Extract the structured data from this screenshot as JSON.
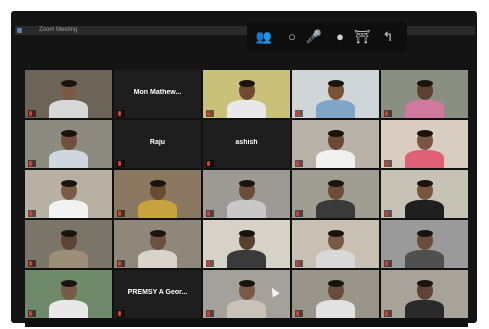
{
  "window": {
    "title": "Zoom Meeting"
  },
  "toolbar": {
    "items": [
      {
        "icon": "participants-icon",
        "glyph": "👥"
      },
      {
        "icon": "record-icon",
        "glyph": "○"
      },
      {
        "icon": "microphone-icon",
        "glyph": "🎤"
      },
      {
        "icon": "camera-icon",
        "glyph": "●"
      },
      {
        "icon": "share-icon",
        "glyph": "⛩"
      },
      {
        "icon": "leave-icon",
        "glyph": "↰"
      }
    ]
  },
  "colors": {
    "active_speaker": "#e8d631",
    "muted_mic": "#e03a2a",
    "tile_bg": "#1c1c1c"
  },
  "grid": {
    "rows": [
      [
        {
          "type": "video",
          "name": "",
          "bg": "#6b6457",
          "skin": "#7a5a45",
          "shirt": "#d8d8d8"
        },
        {
          "type": "name",
          "name": "Mon Mathew..."
        },
        {
          "type": "video",
          "name": "",
          "bg": "#c9c17a",
          "skin": "#6e4a32",
          "shirt": "#e8e8e8",
          "active": true
        },
        {
          "type": "video",
          "name": "",
          "bg": "#cfd6d8",
          "skin": "#7a5238",
          "shirt": "#7fa6c8"
        },
        {
          "type": "video",
          "name": "",
          "bg": "#8a8f83",
          "skin": "#5e4030",
          "shirt": "#d07aa0"
        }
      ],
      [
        {
          "type": "video",
          "name": "",
          "bg": "#8d8a80",
          "skin": "#70503c",
          "shirt": "#cfd6df"
        },
        {
          "type": "name",
          "name": "Raju"
        },
        {
          "type": "name",
          "name": "ashish"
        },
        {
          "type": "video",
          "name": "",
          "bg": "#b8b2a8",
          "skin": "#6c4a36",
          "shirt": "#f0f0f0"
        },
        {
          "type": "video",
          "name": "",
          "bg": "#d8cdc0",
          "skin": "#7a5542",
          "shirt": "#e0607a"
        }
      ],
      [
        {
          "type": "video",
          "name": "",
          "bg": "#b7b0a3",
          "skin": "#7b5b46",
          "shirt": "#f2f2f2"
        },
        {
          "type": "video",
          "name": "",
          "bg": "#8a7860",
          "skin": "#6a4a35",
          "shirt": "#c8a23c"
        },
        {
          "type": "video",
          "name": "",
          "bg": "#9b9a94",
          "skin": "#6a4d3a",
          "shirt": "#c8c8c8"
        },
        {
          "type": "video",
          "name": "",
          "bg": "#a09d92",
          "skin": "#6e4d38",
          "shirt": "#3a3a3a"
        },
        {
          "type": "video",
          "name": "",
          "bg": "#c7c2b6",
          "skin": "#7a5640",
          "shirt": "#1f1f1f"
        }
      ],
      [
        {
          "type": "video",
          "name": "",
          "bg": "#7b7468",
          "skin": "#5e4434",
          "shirt": "#9c8e76"
        },
        {
          "type": "video",
          "name": "",
          "bg": "#8e877a",
          "skin": "#6c5040",
          "shirt": "#d8d4cc"
        },
        {
          "type": "video",
          "name": "",
          "bg": "#d7d2c8",
          "skin": "#5a4030",
          "shirt": "#3a3a3a"
        },
        {
          "type": "video",
          "name": "",
          "bg": "#c8c0b2",
          "skin": "#7a5a44",
          "shirt": "#d8d8d8"
        },
        {
          "type": "video",
          "name": "",
          "bg": "#9a9a9a",
          "skin": "#6a4c3a",
          "shirt": "#505050"
        }
      ],
      [
        {
          "type": "video",
          "name": "",
          "bg": "#6f8a6a",
          "skin": "#7a5a46",
          "shirt": "#e8e8e8"
        },
        {
          "type": "name",
          "name": "PREMSY A Geor..."
        },
        {
          "type": "video",
          "name": "",
          "bg": "#a4a09a",
          "skin": "#7a5a46",
          "shirt": "#c8c2b8"
        },
        {
          "type": "video",
          "name": "",
          "bg": "#9a958a",
          "skin": "#6a4c3a",
          "shirt": "#e2e2e2"
        },
        {
          "type": "video",
          "name": "",
          "bg": "#a7a39a",
          "skin": "#5e4434",
          "shirt": "#2a2a2a"
        }
      ]
    ]
  }
}
